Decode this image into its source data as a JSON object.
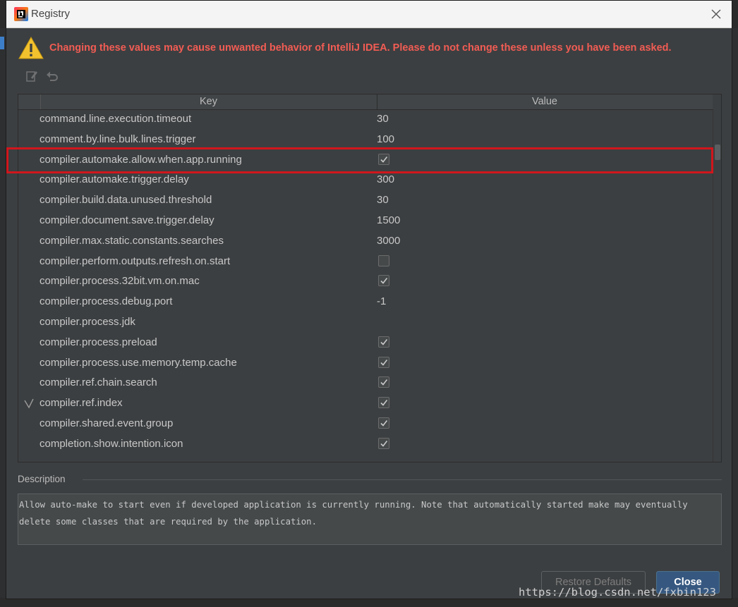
{
  "window": {
    "title": "Registry"
  },
  "warning": {
    "text": "Changing these values may cause unwanted behavior of IntelliJ IDEA. Please do not change these unless you have been asked."
  },
  "toolbar": {
    "icons": [
      "edit-icon",
      "revert-icon"
    ]
  },
  "table": {
    "columns": [
      "Key",
      "Value"
    ],
    "rows": [
      {
        "key": "command.line.execution.timeout",
        "value": "30",
        "type": "text"
      },
      {
        "key": "comment.by.line.bulk.lines.trigger",
        "value": "100",
        "type": "text"
      },
      {
        "key": "compiler.automake.allow.when.app.running",
        "checked": true,
        "type": "checkbox",
        "highlighted": true
      },
      {
        "key": "compiler.automake.trigger.delay",
        "value": "300",
        "type": "text"
      },
      {
        "key": "compiler.build.data.unused.threshold",
        "value": "30",
        "type": "text"
      },
      {
        "key": "compiler.document.save.trigger.delay",
        "value": "1500",
        "type": "text"
      },
      {
        "key": "compiler.max.static.constants.searches",
        "value": "3000",
        "type": "text"
      },
      {
        "key": "compiler.perform.outputs.refresh.on.start",
        "checked": false,
        "type": "checkbox"
      },
      {
        "key": "compiler.process.32bit.vm.on.mac",
        "checked": true,
        "type": "checkbox"
      },
      {
        "key": "compiler.process.debug.port",
        "value": "-1",
        "type": "text"
      },
      {
        "key": "compiler.process.jdk",
        "value": "",
        "type": "text"
      },
      {
        "key": "compiler.process.preload",
        "checked": true,
        "type": "checkbox"
      },
      {
        "key": "compiler.process.use.memory.temp.cache",
        "checked": true,
        "type": "checkbox"
      },
      {
        "key": "compiler.ref.chain.search",
        "checked": true,
        "type": "checkbox"
      },
      {
        "key": "compiler.ref.index",
        "checked": true,
        "type": "checkbox",
        "modified": true
      },
      {
        "key": "compiler.shared.event.group",
        "checked": true,
        "type": "checkbox"
      },
      {
        "key": "completion.show.intention.icon",
        "checked": true,
        "type": "checkbox"
      }
    ]
  },
  "description": {
    "label": "Description",
    "text": "Allow auto-make to start even if developed application is currently running. Note that automatically started make may eventually delete some classes that are required by the application."
  },
  "buttons": {
    "restore": "Restore Defaults",
    "close": "Close"
  },
  "watermark": "https://blog.csdn.net/fxbin123",
  "colors": {
    "warning": "#f25c54",
    "highlight": "#d0161c",
    "primary_button": "#365880"
  }
}
